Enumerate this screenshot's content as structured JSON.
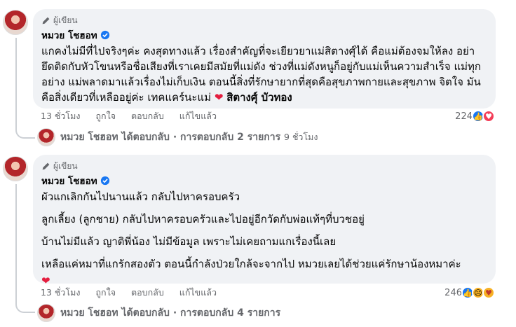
{
  "comments": [
    {
      "badge": "ผู้เขียน",
      "author": "หมวย โชฮอท",
      "paragraphs": [
        "แกคงไม่มีที่ไปจริงๆค่ะ คงสุดทางแล้ว เรื่องสำคัญที่จะเยียวยาแม่สิตางศุ์ได้ คือแม่ต้องจมให้ลง อย่ายึดติดกับหัวโขนหรือชื่อเสียงที่เราเคยมีสมัยที่แม่ดัง ช่วงที่แม่ดังหนูก็อยู่กับแม่เห็นความสำเร็จ แม่ทุกอย่าง แม่พลาดมาแล้วเรื่องไม่เก็บเงิน ตอนนี้สิ่งที่รักษายากที่สุดคือสุขภาพกายและสุขภาพ จิตใจ มันคือสิ่งเดียวที่เหลืออยู่ค่ะ เทคแคร์นะแม่"
      ],
      "mention": "สิตางศุ์ บัวทอง",
      "time": "13 ชั่วโมง",
      "like": "ถูกใจ",
      "reply": "ตอบกลับ",
      "edited": "แก้ไขแล้ว",
      "reaction_count": "224",
      "reply_summary": {
        "name": "หมวย โชฮอท",
        "text": "ได้ตอบกลับ · การตอบกลับ 2 รายการ",
        "time": "9 ชั่วโมง"
      }
    },
    {
      "badge": "ผู้เขียน",
      "author": "หมวย โชฮอท",
      "paragraphs": [
        "ผัวแกเลิกกันไปนานแล้ว กลับไปหาครอบครัว",
        "ลูกเลี้ยง (ลูกชาย) กลับไปหาครอบครัวและไปอยู่อีกวัดกับพ่อแท้ๆที่บวชอยู่",
        "บ้านไม่มีแล้ว ญาติพี่น้อง ไม่มีข้อมูล เพราะไม่เคยถามแกเรื่องนี้เลย",
        "เหลือแค่หมาที่แกรักสองตัว ตอนนี้กำลังป่วยใกล้จะจากไป หมวยเลยได้ช่วยแค่รักษาน้องหมาค่ะ"
      ],
      "time": "13 ชั่วโมง",
      "like": "ถูกใจ",
      "reply": "ตอบกลับ",
      "edited": "แก้ไขแล้ว",
      "reaction_count": "246",
      "reply_summary": {
        "name": "หมวย โชฮอท",
        "text": "ได้ตอบกลับ · การตอบกลับ 4 รายการ"
      }
    }
  ],
  "colors": {
    "bubble": "#f0f2f5",
    "secondary_text": "#65676b",
    "like_blue": "#1877f2",
    "heart_red": "#e41e3f"
  }
}
